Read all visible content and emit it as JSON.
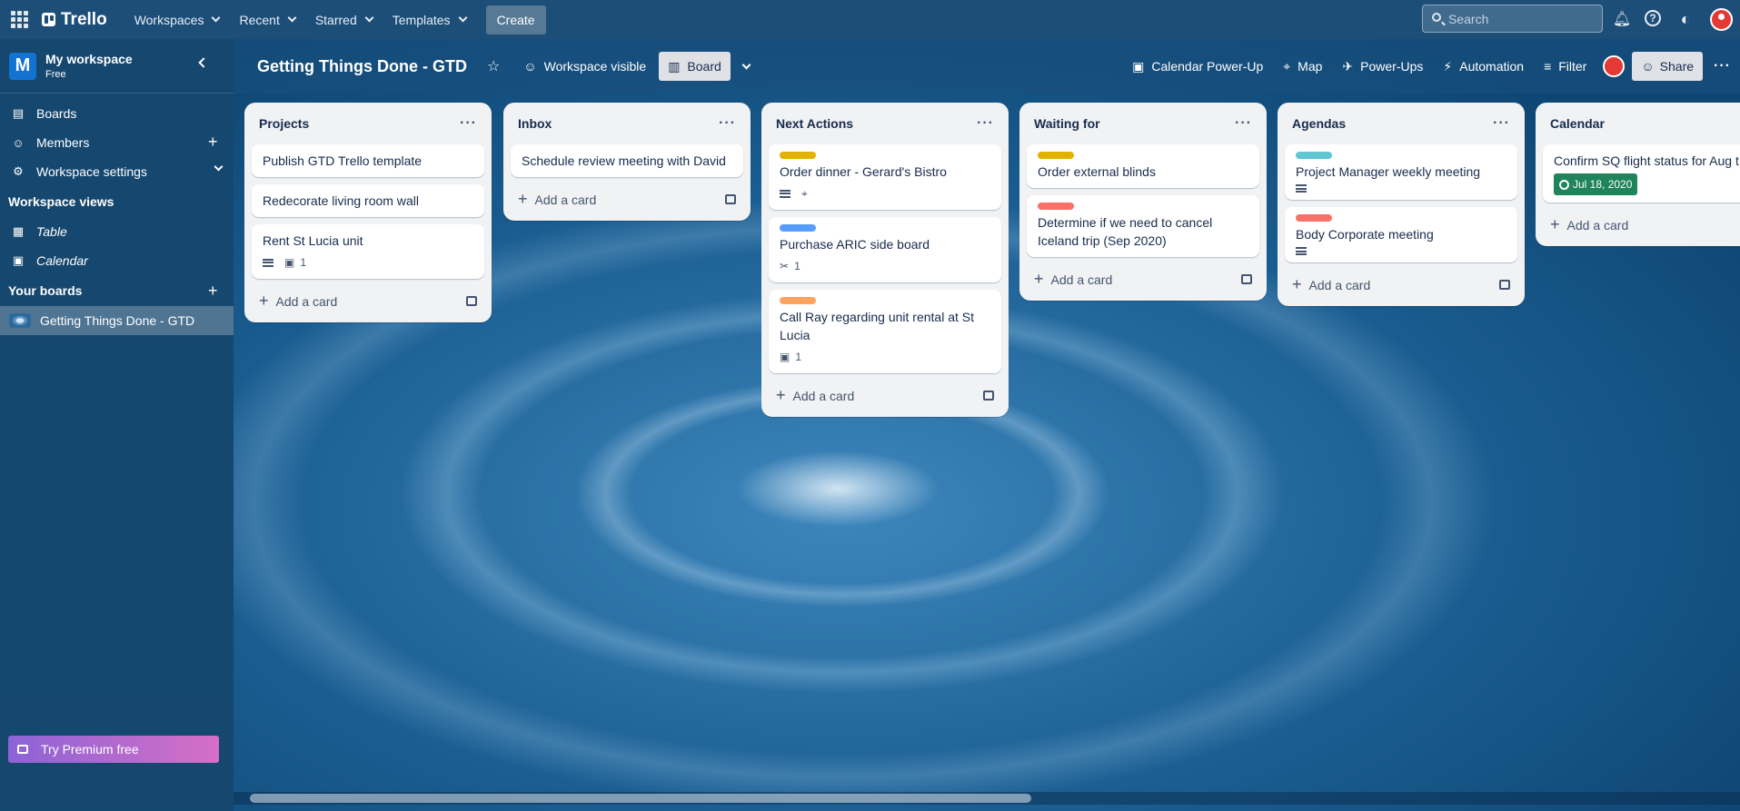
{
  "header": {
    "brand": "Trello",
    "nav": [
      {
        "label": "Workspaces"
      },
      {
        "label": "Recent"
      },
      {
        "label": "Starred"
      },
      {
        "label": "Templates"
      }
    ],
    "create_label": "Create",
    "search_placeholder": "Search"
  },
  "sidebar": {
    "workspace_name": "My workspace",
    "workspace_plan": "Free",
    "workspace_initial": "M",
    "items": [
      {
        "label": "Boards"
      },
      {
        "label": "Members"
      },
      {
        "label": "Workspace settings"
      }
    ],
    "views_heading": "Workspace views",
    "views": [
      {
        "label": "Table"
      },
      {
        "label": "Calendar"
      }
    ],
    "your_boards_heading": "Your boards",
    "boards": [
      {
        "label": "Getting Things Done - GTD"
      }
    ],
    "premium_label": "Try Premium free"
  },
  "board": {
    "title": "Getting Things Done - GTD",
    "visibility": "Workspace visible",
    "view": "Board",
    "actions": [
      {
        "label": "Calendar Power-Up"
      },
      {
        "label": "Map"
      },
      {
        "label": "Power-Ups"
      },
      {
        "label": "Automation"
      },
      {
        "label": "Filter"
      }
    ],
    "share_label": "Share",
    "add_card_label": "Add a card"
  },
  "lists": [
    {
      "name": "Projects",
      "cards": [
        {
          "title": "Publish GTD Trello template"
        },
        {
          "title": "Redecorate living room wall"
        },
        {
          "title": "Rent St Lucia unit",
          "checklist": "1"
        }
      ]
    },
    {
      "name": "Inbox",
      "cards": [
        {
          "title": "Schedule review meeting with David"
        }
      ]
    },
    {
      "name": "Next Actions",
      "cards": [
        {
          "title": "Order dinner - Gerard's Bistro",
          "label_color": "#e2b203"
        },
        {
          "title": "Purchase ARIC side board",
          "label_color": "#579dff",
          "attachments": "1"
        },
        {
          "title": "Call Ray regarding unit rental at St Lucia",
          "label_color": "#fea362",
          "checklist": "1"
        }
      ]
    },
    {
      "name": "Waiting for",
      "cards": [
        {
          "title": "Order external blinds",
          "label_color": "#e2b203"
        },
        {
          "title": "Determine if we need to cancel Iceland trip (Sep 2020)",
          "label_color": "#f87168"
        }
      ]
    },
    {
      "name": "Agendas",
      "cards": [
        {
          "title": "Project Manager weekly meeting",
          "label_color": "#60c6d2"
        },
        {
          "title": "Body Corporate meeting",
          "label_color": "#f87168"
        }
      ]
    },
    {
      "name": "Calendar",
      "cards": [
        {
          "title": "Confirm SQ flight status for Aug t",
          "due": "Jul 18, 2020"
        }
      ]
    }
  ]
}
